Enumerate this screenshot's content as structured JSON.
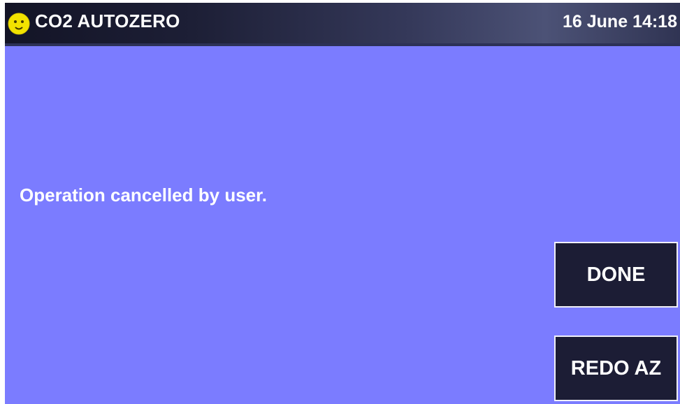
{
  "header": {
    "title": "CO2 AUTOZERO",
    "datetime": "16 June 14:18",
    "status_icon": "smiley-face-icon",
    "status_icon_color": "#f2e200"
  },
  "main": {
    "message": "Operation cancelled by user."
  },
  "buttons": {
    "done_label": "DONE",
    "redo_label": "REDO AZ"
  },
  "colors": {
    "background": "#7b7cff",
    "button": "#1c1d35",
    "text": "#ffffff"
  }
}
